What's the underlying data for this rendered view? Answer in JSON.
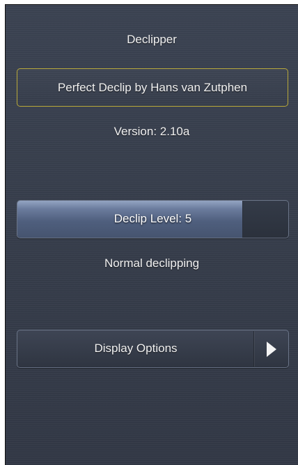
{
  "header": {
    "title": "Declipper"
  },
  "product": {
    "name": "Perfect Declip by Hans van Zutphen"
  },
  "version": {
    "text": "Version: 2.10a"
  },
  "declip_level": {
    "label": "Declip Level: 5",
    "value": 5,
    "fill_fraction": 0.83
  },
  "mode": {
    "text": "Normal declipping"
  },
  "display_options": {
    "label": "Display Options",
    "arrow_icon": "play-arrow-icon"
  },
  "colors": {
    "background": "#363d4b",
    "product_border": "#b9a93a",
    "slider_fill": "#5c6c8c",
    "text": "#f2f2f2"
  }
}
